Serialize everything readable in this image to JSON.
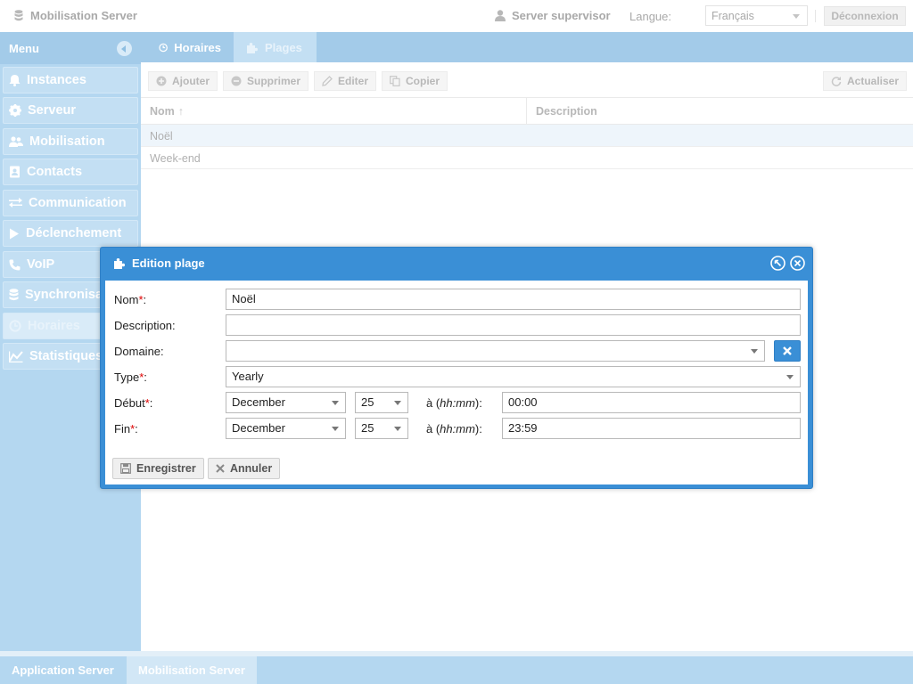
{
  "header": {
    "app_title": "Mobilisation Server",
    "user": "Server supervisor",
    "language_label": "Langue:",
    "language_value": "Français",
    "logout_label": "Déconnexion"
  },
  "sidebar": {
    "title": "Menu",
    "items": [
      {
        "label": "Instances",
        "icon": "bell-icon"
      },
      {
        "label": "Serveur",
        "icon": "gear-icon"
      },
      {
        "label": "Mobilisation",
        "icon": "users-icon"
      },
      {
        "label": "Contacts",
        "icon": "address-book-icon"
      },
      {
        "label": "Communication",
        "icon": "exchange-icon"
      },
      {
        "label": "Déclenchement",
        "icon": "play-icon"
      },
      {
        "label": "VoIP",
        "icon": "phone-icon"
      },
      {
        "label": "Synchronisation",
        "icon": "database-icon"
      },
      {
        "label": "Horaires",
        "icon": "clock-icon",
        "active": true
      },
      {
        "label": "Statistiques",
        "icon": "chart-line-icon"
      }
    ]
  },
  "tabs": [
    {
      "label": "Horaires",
      "icon": "clock-icon"
    },
    {
      "label": "Plages",
      "icon": "puzzle-icon",
      "active": true
    }
  ],
  "toolbar": {
    "add_label": "Ajouter",
    "delete_label": "Supprimer",
    "edit_label": "Editer",
    "copy_label": "Copier",
    "refresh_label": "Actualiser"
  },
  "grid": {
    "columns": [
      "Nom",
      "Description"
    ],
    "rows": [
      {
        "name": "Noël",
        "description": ""
      },
      {
        "name": "Week-end",
        "description": ""
      }
    ]
  },
  "dialog": {
    "title": "Edition plage",
    "name_label": "Nom",
    "name_value": "Noël",
    "description_label": "Description:",
    "description_value": "",
    "domain_label": "Domaine:",
    "domain_value": "",
    "type_label": "Type",
    "type_value": "Yearly",
    "start_label": "Début",
    "start_month": "December",
    "start_day": "25",
    "start_time": "00:00",
    "end_label": "Fin",
    "end_month": "December",
    "end_day": "25",
    "end_time": "23:59",
    "at_prefix": "à (",
    "time_format": "hh:mm",
    "at_suffix": "):",
    "save_label": "Enregistrer",
    "cancel_label": "Annuler"
  },
  "bottom_tabs": [
    "Application Server",
    "Mobilisation Server"
  ],
  "colors": {
    "accent": "#3a8fd6",
    "sidebar": "#b4d7f0",
    "required": "#dd0000"
  }
}
